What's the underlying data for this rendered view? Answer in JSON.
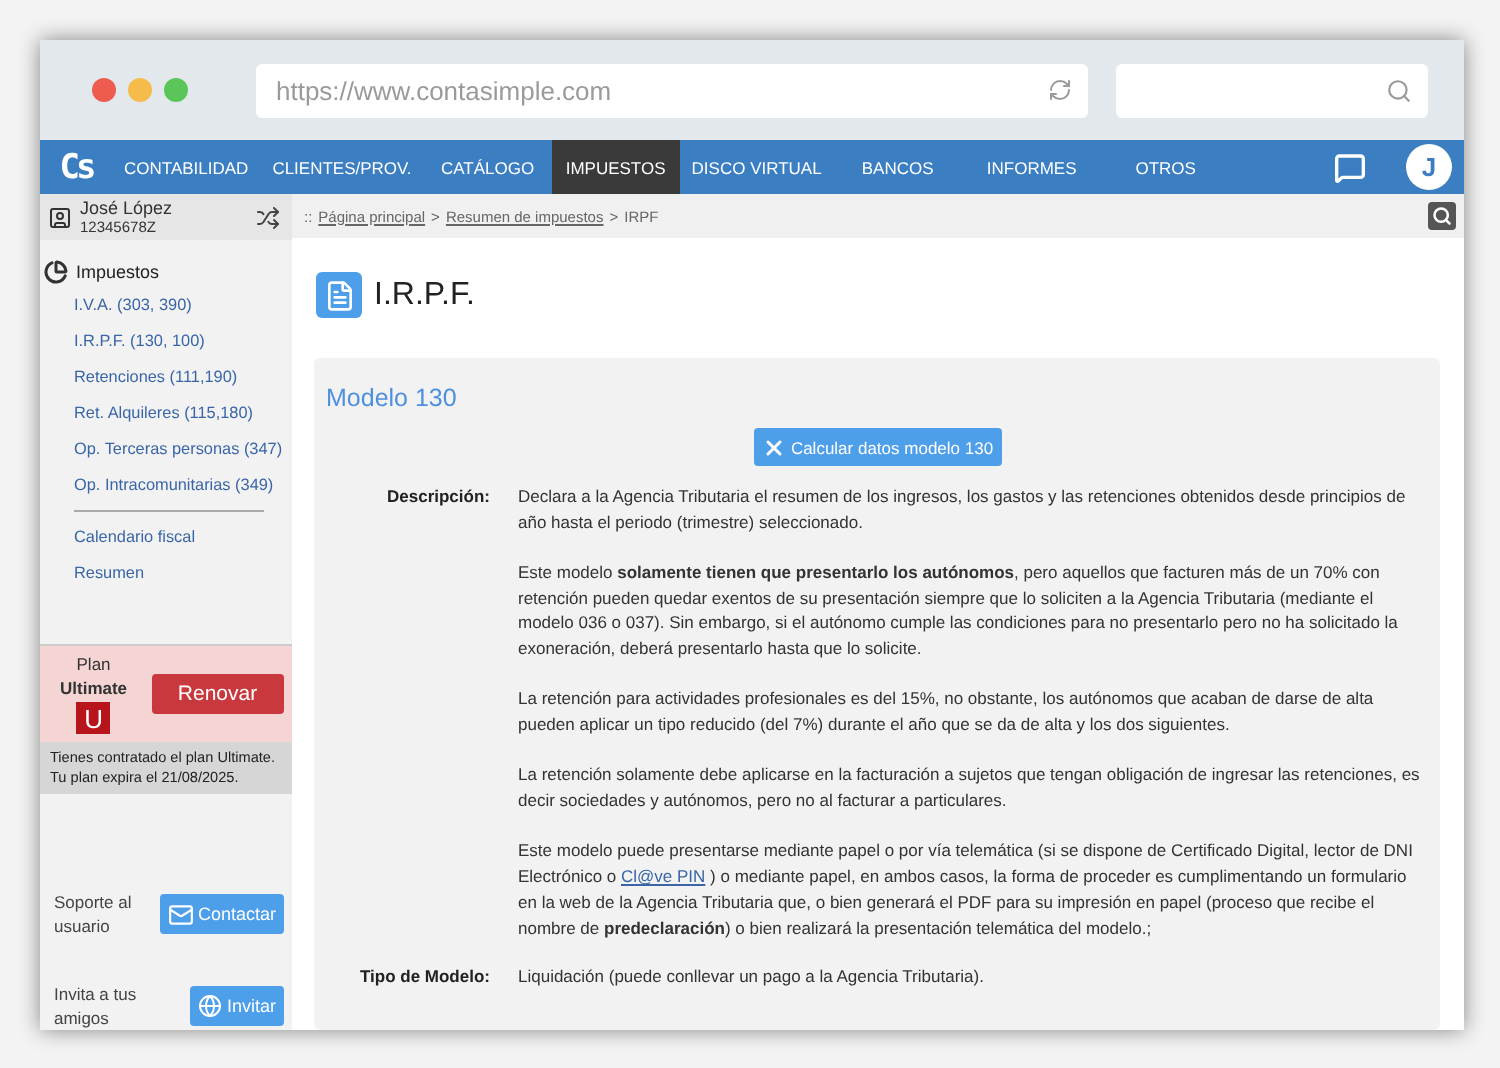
{
  "browser": {
    "url": "https://www.contasimple.com"
  },
  "nav": {
    "logo": "Cs",
    "items": [
      {
        "label": "CONTABILIDAD",
        "selected": false
      },
      {
        "label": "CLIENTES/PROV.",
        "selected": false
      },
      {
        "label": "CATÁLOGO",
        "selected": false
      },
      {
        "label": "IMPUESTOS",
        "selected": true
      },
      {
        "label": "DISCO VIRTUAL",
        "selected": false
      },
      {
        "label": "BANCOS",
        "selected": false
      },
      {
        "label": "INFORMES",
        "selected": false
      },
      {
        "label": "OTROS",
        "selected": false
      }
    ],
    "avatar": "J"
  },
  "user": {
    "name": "José López",
    "id": "12345678Z"
  },
  "sidebar": {
    "title": "Impuestos",
    "items": [
      "I.V.A. (303, 390)",
      "I.R.P.F. (130, 100)",
      "Retenciones (111,190)",
      "Ret. Alquileres (115,180)",
      "Op. Terceras personas (347)",
      "Op. Intracomunitarias (349)"
    ],
    "extra_items": [
      "Calendario fiscal",
      "Resumen"
    ]
  },
  "plan": {
    "label": "Plan",
    "name": "Ultimate",
    "badge": "U",
    "button": "Renovar",
    "note": "Tienes contratado el plan Ultimate. Tu plan expira el 21/08/2025."
  },
  "support": {
    "text": "Soporte al usuario",
    "button": "Contactar"
  },
  "invite": {
    "text": "Invita a tus amigos",
    "button": "Invitar"
  },
  "breadcrumb": {
    "prefix": "::",
    "links": [
      "Página principal",
      "Resumen de impuestos"
    ],
    "separator": ">",
    "current": "IRPF"
  },
  "page_title": "I.R.P.F.",
  "card": {
    "title": "Modelo 130",
    "button": "Calcular datos modelo 130",
    "fields": [
      {
        "label": "Descripción:",
        "paragraphs": [
          [
            {
              "kind": "text",
              "text": "Declara a la Agencia Tributaria el resumen de los ingresos, los gastos y las retenciones obtenidos desde principios de año hasta el periodo (trimestre) seleccionado."
            }
          ],
          [
            {
              "kind": "text",
              "text": "Este modelo **solamente tienen que presentarlo los autónomos**, pero aquellos que facturen más de un 70% con retención pueden quedar exentos de su presentación siempre que lo soliciten a la Agencia Tributaria (mediante el modelo 036 o 037). Sin embargo, si el autónomo cumple las condiciones para no presentarlo pero no ha solicitado la exoneración, deberá presentarlo hasta que lo solicite."
            }
          ],
          [
            {
              "kind": "text",
              "text": "La retención para actividades profesionales es del 15%, no obstante, los autónomos que acaban de darse de alta pueden aplicar un tipo reducido (del 7%) durante el año que se da de alta y los dos siguientes."
            }
          ],
          [
            {
              "kind": "text",
              "text": "La retención solamente debe aplicarse en la facturación a sujetos que tengan obligación de ingresar las retenciones, es decir sociedades y autónomos, pero no al facturar a particulares."
            }
          ],
          [
            {
              "kind": "text",
              "text": "Este modelo puede presentarse mediante papel o por vía telemática (si se dispone de Certificado Digital, lector de DNI Electrónico o "
            },
            {
              "kind": "link",
              "text": "Cl@ve PIN"
            },
            {
              "kind": "text",
              "text": " ) o mediante papel, en ambos casos, la forma de proceder es cumplimentando un formulario en la web de la Agencia Tributaria que, o bien generará el PDF para su impresión en papel (proceso que recibe el nombre de **predeclaración**) o bien realizará la presentación telemática del modelo.;"
            }
          ]
        ]
      },
      {
        "label": "Tipo de Modelo:",
        "paragraphs": [
          [
            {
              "kind": "text",
              "text": "Liquidación (puede conllevar un pago a la Agencia Tributaria)."
            }
          ]
        ]
      }
    ]
  }
}
